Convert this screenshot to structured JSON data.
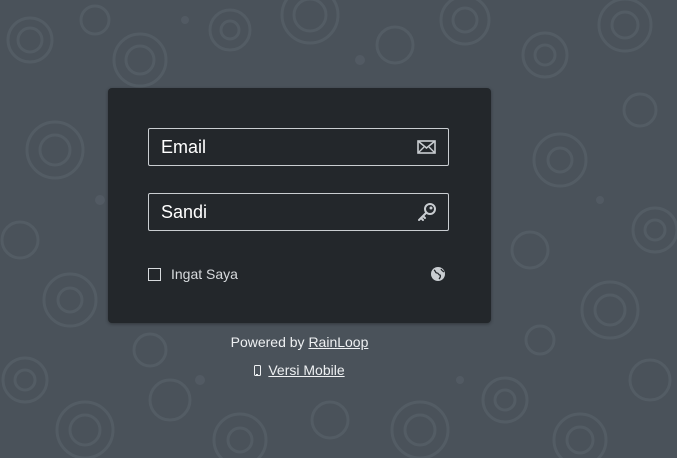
{
  "login": {
    "email": {
      "placeholder": "Email",
      "value": "",
      "icon": "envelope-icon"
    },
    "password": {
      "placeholder": "Sandi",
      "value": "",
      "icon": "key-icon"
    },
    "remember_label": "Ingat Saya",
    "remember_checked": false,
    "language_icon": "globe-icon"
  },
  "footer": {
    "powered_prefix": "Powered by",
    "powered_link": "RainLoop",
    "mobile_icon": "mobile-phone-icon",
    "mobile_link": "Versi Mobile"
  },
  "colors": {
    "background": "#4a525a",
    "panel": "#23272b",
    "field_border": "#c9cdd1",
    "text": "#ffffff"
  }
}
